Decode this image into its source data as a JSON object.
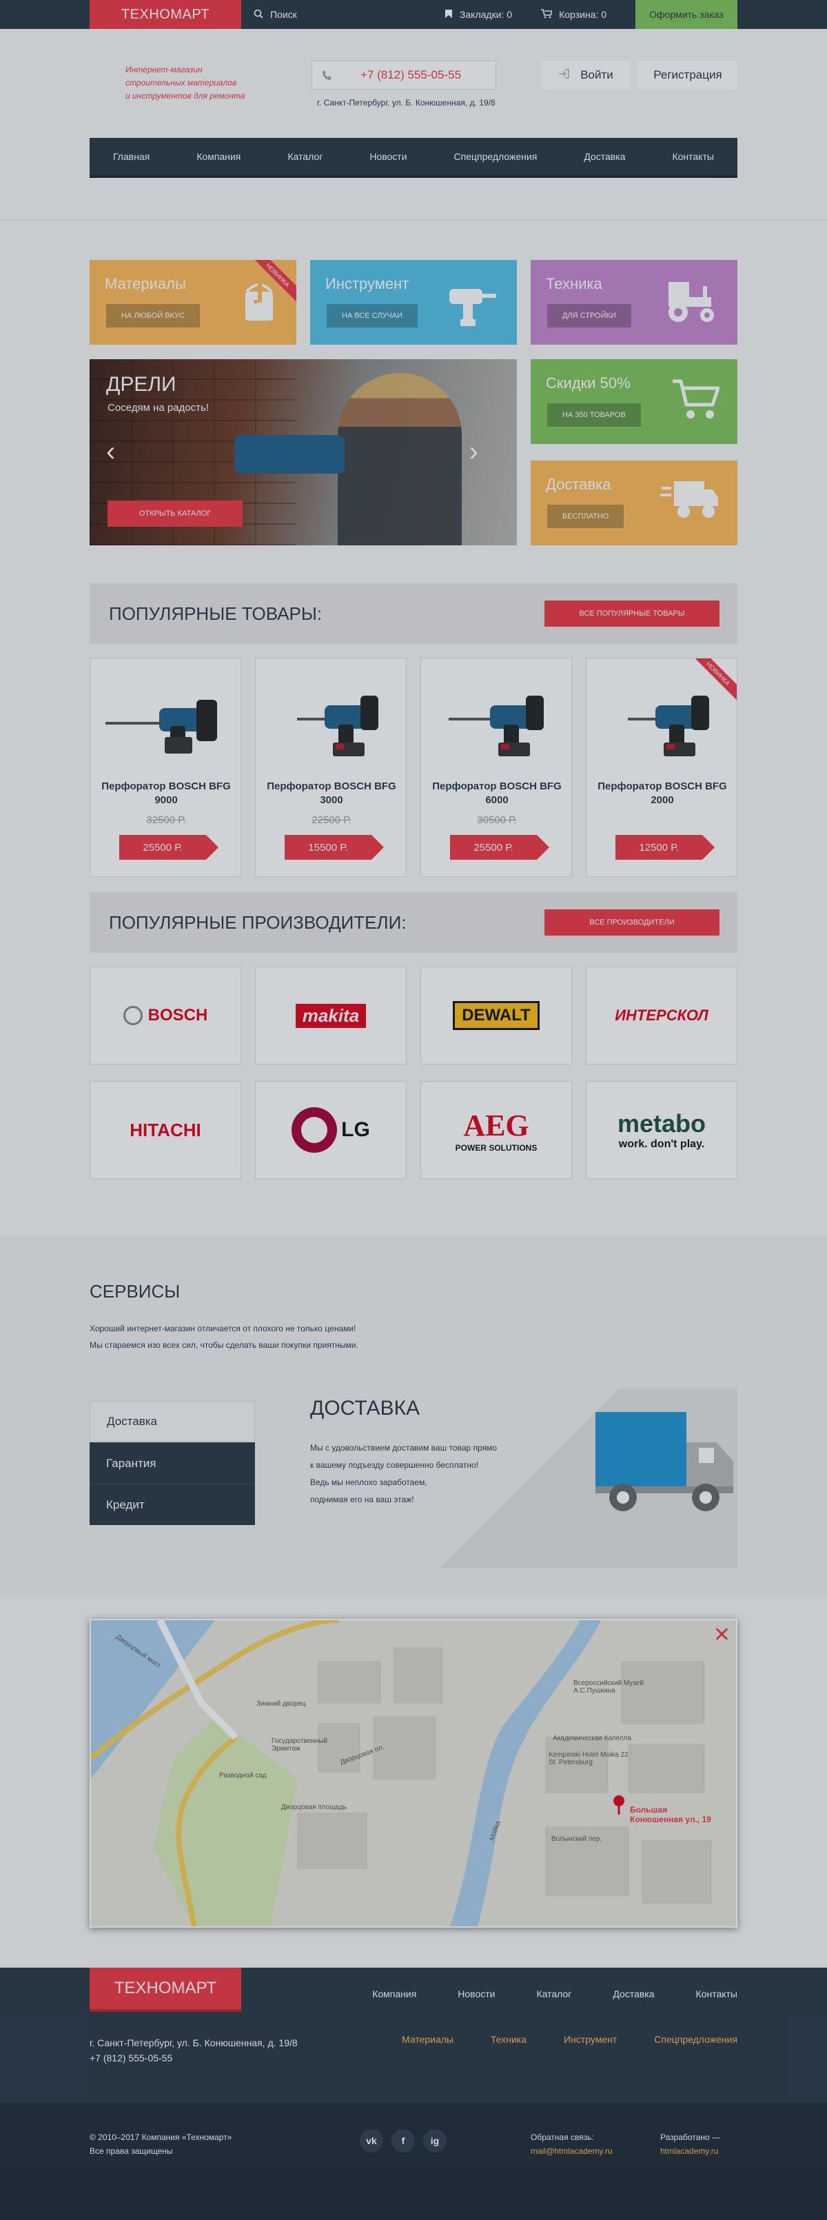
{
  "topbar": {
    "logo": "ТЕХНОМАРТ",
    "search": "Поиск",
    "bookmarks": "Закладки: 0",
    "cart": "Корзина: 0",
    "order": "Оформить заказ"
  },
  "header": {
    "slogan": [
      "Интернет-магазин",
      "строительных материалов",
      "и инструментов для ремонта"
    ],
    "phone": "+7 (812) 555-05-55",
    "address": "г. Санкт-Петербург, ул. Б. Конюшенная, д. 19/8",
    "login": "Войти",
    "register": "Регистрация"
  },
  "nav": [
    "Главная",
    "Компания",
    "Каталог",
    "Новости",
    "Спецпредложения",
    "Доставка",
    "Контакты"
  ],
  "tiles": [
    {
      "title": "Материалы",
      "button": "НА ЛЮБОЙ ВКУС",
      "color": "#fdba58",
      "ribbon": "НОВИНКА"
    },
    {
      "title": "Инструмент",
      "button": "НА ВСЕ СЛУЧАИ",
      "color": "#52c1e6"
    },
    {
      "title": "Техника",
      "button": "ДЛЯ СТРОЙКИ",
      "color": "#c586cf"
    },
    {
      "title": "Скидки 50%",
      "button": "НА 350 ТОВАРОВ",
      "color": "#7fc35c"
    },
    {
      "title": "Доставка",
      "button": "БЕСПЛАТНО",
      "color": "#fdba58"
    }
  ],
  "slider": {
    "title": "ДРЕЛИ",
    "subtitle": "Соседям на радость!",
    "button": "ОТКРЫТЬ КАТАЛОГ"
  },
  "popular": {
    "title": "ПОПУЛЯРНЫЕ ТОВАРЫ:",
    "button": "ВСЕ ПОПУЛЯРНЫЕ ТОВАРЫ",
    "items": [
      {
        "name": "Перфоратор BOSCH BFG 9000",
        "old": "32500 Р.",
        "price": "25500 Р."
      },
      {
        "name": "Перфоратор BOSCH BFG 3000",
        "old": "22500 Р.",
        "price": "15500 Р."
      },
      {
        "name": "Перфоратор BOSCH BFG 6000",
        "old": "30500 Р.",
        "price": "25500 Р."
      },
      {
        "name": "Перфоратор BOSCH BFG 2000",
        "old": "",
        "price": "12500 Р.",
        "ribbon": "НОВИНКА"
      }
    ]
  },
  "brands": {
    "title": "ПОПУЛЯРНЫЕ ПРОИЗВОДИТЕЛИ:",
    "button": "ВСЕ ПРОИЗВОДИТЕЛИ",
    "items": [
      "BOSCH",
      "makita",
      "DEWALT",
      "ИНТЕРСКОЛ",
      "HITACHI",
      "LG",
      "AEG",
      "POWER SOLUTIONS",
      "metabo",
      "work. don't play."
    ]
  },
  "services": {
    "title": "СЕРВИСЫ",
    "line1": "Хороший интернет-магазин отличается от плохого не только ценами!",
    "line2": "Мы стараемся изо всех сил, чтобы сделать ваши покупки приятными.",
    "tabs": [
      "Доставка",
      "Гарантия",
      "Кредит"
    ],
    "active_title": "ДОСТАВКА",
    "text": [
      "Мы с удовольствием доставим ваш товар прямо",
      "к вашему подъезду совершенно бесплатно!",
      "Ведь мы неплохо заработаем,",
      "поднимая его на ваш этаж!"
    ]
  },
  "map": {
    "labels": [
      "Дворцовый мост",
      "Зимний дворец",
      "Государственный Эрмитаж",
      "Дворцовая пл.",
      "Дворцовая площадь",
      "Разводной сад",
      "Всероссийский Музей А.С.Пушкина",
      "Академическая Капелла",
      "Kempinski Hotel Moika 22 St. Petersburg",
      "Мойка",
      "Волынский пер."
    ],
    "pin_line1": "Большая",
    "pin_line2": "Конюшенная ул., 19",
    "close": "✕"
  },
  "footer": {
    "logo": "ТЕХНОМАРТ",
    "nav": [
      "Компания",
      "Новости",
      "Каталог",
      "Доставка",
      "Контакты"
    ],
    "nav2": [
      "Материалы",
      "Техника",
      "Инструмент",
      "Спецпредложения"
    ],
    "address": "г. Санкт-Петербург, ул. Б. Конюшенная, д. 19/8",
    "phone": "+7 (812) 555-05-55",
    "copyright": "© 2010–2017 Компания «Техномарт»",
    "rights": "Все права защищены",
    "social": [
      "vk",
      "f",
      "ig"
    ],
    "feedback_label": "Обратная связь:",
    "feedback_email": "mail@htmlacademy.ru",
    "dev_label": "Разработано —",
    "dev_site": "htmlacademy.ru"
  }
}
